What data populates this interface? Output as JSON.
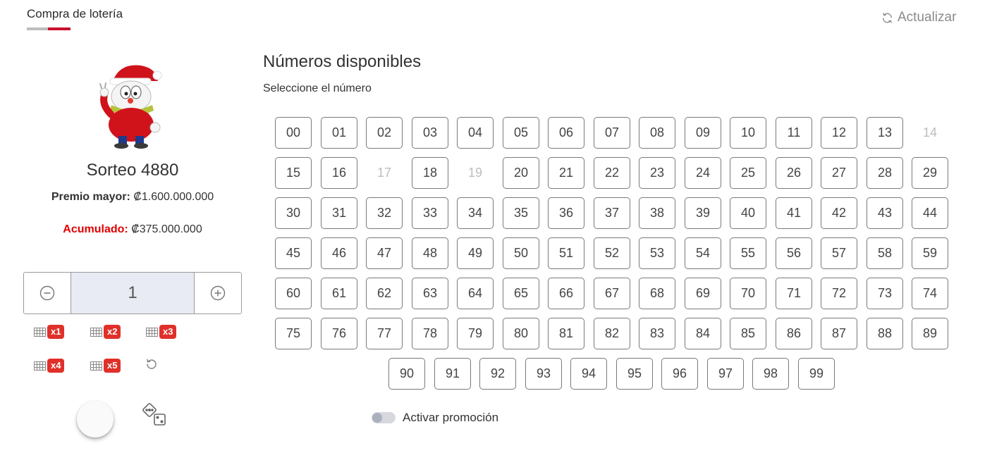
{
  "header": {
    "tab_label": "Compra de lotería",
    "refresh_label": "Actualizar"
  },
  "draw": {
    "title": "Sorteo 4880",
    "prize_label": "Premio mayor:",
    "prize_value": "₡1.600.000.000",
    "accum_label": "Acumulado:",
    "accum_value": "₡375.000.000"
  },
  "stepper": {
    "value": "1"
  },
  "multipliers": [
    "x1",
    "x2",
    "x3",
    "x4",
    "x5"
  ],
  "numbers": {
    "title": "Números disponibles",
    "subtitle": "Seleccione el número",
    "items": [
      "00",
      "01",
      "02",
      "03",
      "04",
      "05",
      "06",
      "07",
      "08",
      "09",
      "10",
      "11",
      "12",
      "13",
      "14",
      "15",
      "16",
      "17",
      "18",
      "19",
      "20",
      "21",
      "22",
      "23",
      "24",
      "25",
      "26",
      "27",
      "28",
      "29",
      "30",
      "31",
      "32",
      "33",
      "34",
      "35",
      "36",
      "37",
      "38",
      "39",
      "40",
      "41",
      "42",
      "43",
      "44",
      "45",
      "46",
      "47",
      "48",
      "49",
      "50",
      "51",
      "52",
      "53",
      "54",
      "55",
      "56",
      "57",
      "58",
      "59",
      "60",
      "61",
      "62",
      "63",
      "64",
      "65",
      "66",
      "67",
      "68",
      "69",
      "70",
      "71",
      "72",
      "73",
      "74",
      "75",
      "76",
      "77",
      "78",
      "79",
      "80",
      "81",
      "82",
      "83",
      "84",
      "85",
      "86",
      "87",
      "88",
      "89",
      "90",
      "91",
      "92",
      "93",
      "94",
      "95",
      "96",
      "97",
      "98",
      "99"
    ],
    "unavailable": [
      "14",
      "17",
      "19"
    ]
  },
  "promo": {
    "label": "Activar promoción",
    "enabled": false
  },
  "colors": {
    "accent_red": "#c8102e",
    "badge_red": "#e0302a",
    "accum_red": "#e00000",
    "stepper_bg": "#e8ebf3"
  },
  "icons": {
    "refresh": "refresh-icon",
    "minus": "minus-circle-icon",
    "plus": "plus-circle-icon",
    "grid": "ticket-grid-icon",
    "reset": "reset-icon",
    "dice": "dice-icon",
    "mascot": "mascot-image"
  }
}
